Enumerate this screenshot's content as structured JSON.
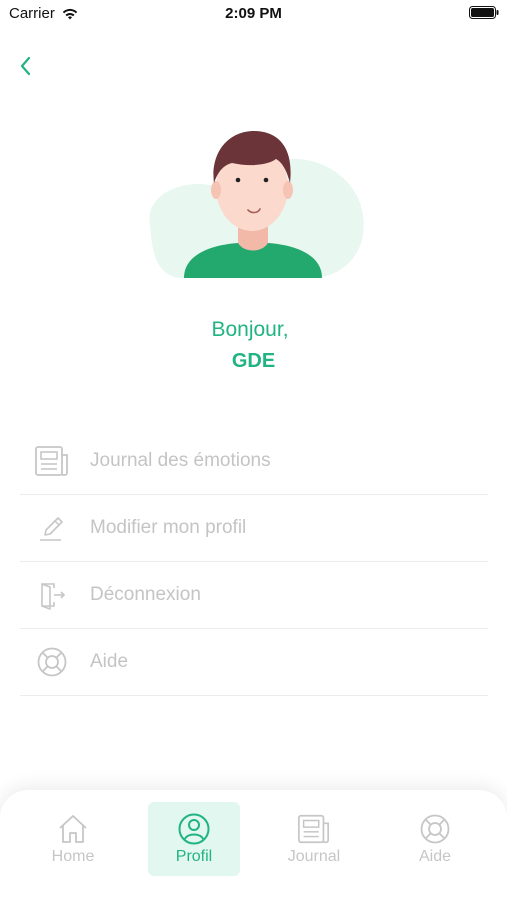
{
  "status_bar": {
    "carrier": "Carrier",
    "time": "2:09 PM"
  },
  "profile": {
    "greeting": "Bonjour,",
    "name": "GDE"
  },
  "menu": {
    "items": [
      {
        "label": "Journal des émotions",
        "icon": "newspaper-icon"
      },
      {
        "label": "Modifier mon profil",
        "icon": "pencil-icon"
      },
      {
        "label": "Déconnexion",
        "icon": "logout-door-icon"
      },
      {
        "label": "Aide",
        "icon": "lifebuoy-icon"
      }
    ]
  },
  "tabs": [
    {
      "label": "Home",
      "icon": "home-icon",
      "active": false
    },
    {
      "label": "Profil",
      "icon": "user-circle-icon",
      "active": true
    },
    {
      "label": "Journal",
      "icon": "newspaper-icon",
      "active": false
    },
    {
      "label": "Aide",
      "icon": "lifebuoy-icon",
      "active": false
    }
  ],
  "colors": {
    "accent": "#22b383",
    "active_tab_bg": "#e2f7ef",
    "muted": "#c4c4c4"
  }
}
